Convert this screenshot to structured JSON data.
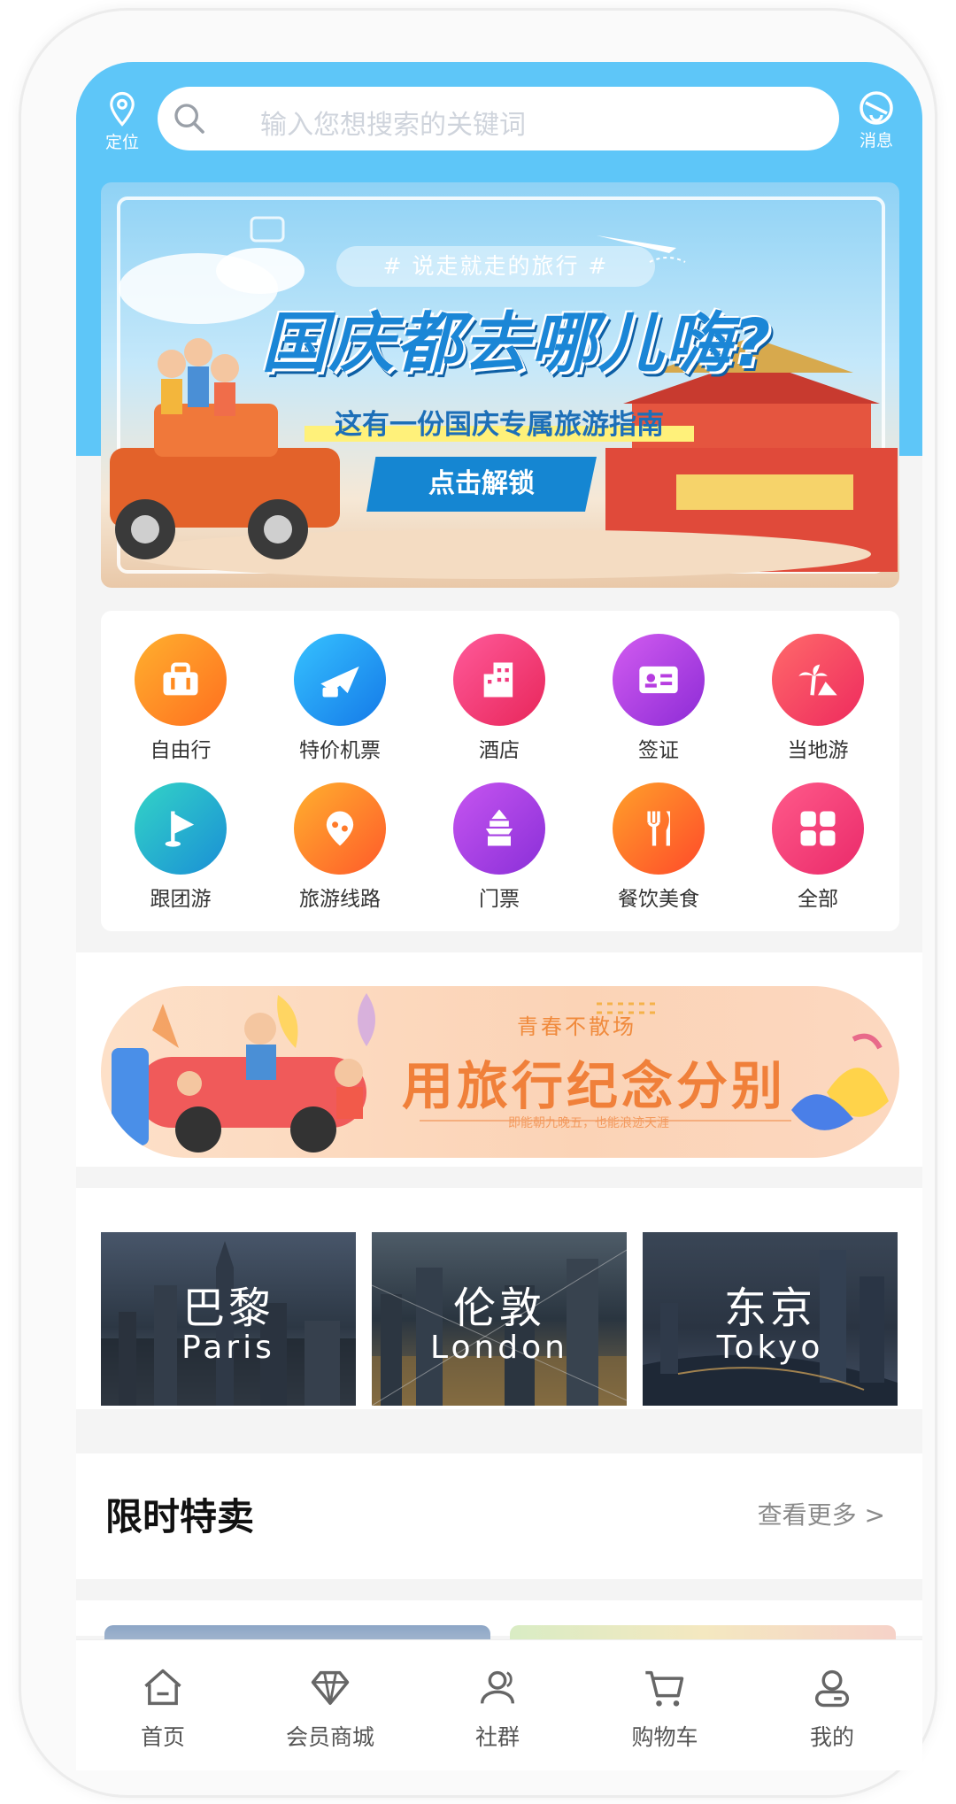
{
  "header": {
    "location_label": "定位",
    "search_placeholder": "输入您想搜索的关键词",
    "message_label": "消息"
  },
  "banner": {
    "tagline": "# 说走就走的旅行 #",
    "headline": "国庆都去哪儿嗨?",
    "subtitle": "这有一份国庆专属旅游指南",
    "button": "点击解锁"
  },
  "categories": [
    {
      "label": "自由行",
      "icon": "suitcase-icon",
      "color": "#ff8a1f"
    },
    {
      "label": "特价机票",
      "icon": "plane-icon",
      "color": "#1ea1f2"
    },
    {
      "label": "酒店",
      "icon": "building-icon",
      "color": "#f23c7e"
    },
    {
      "label": "签证",
      "icon": "id-card-icon",
      "color": "#b73de0"
    },
    {
      "label": "当地游",
      "icon": "palm-tree-icon",
      "color": "#f43f5e"
    },
    {
      "label": "跟团游",
      "icon": "flag-icon",
      "color": "#1fb8c9"
    },
    {
      "label": "旅游线路",
      "icon": "map-pin-icon",
      "color": "#ff7a2a"
    },
    {
      "label": "门票",
      "icon": "temple-icon",
      "color": "#a23ddf"
    },
    {
      "label": "餐饮美食",
      "icon": "fork-knife-icon",
      "color": "#ff6a2b"
    },
    {
      "label": "全部",
      "icon": "grid-icon",
      "color": "#f03a79"
    }
  ],
  "promo": {
    "kicker": "青春不散场",
    "headline": "用旅行纪念分别",
    "fine_print": "即能朝九晚五，也能浪迹天涯"
  },
  "cities": [
    {
      "cn": "巴黎",
      "en": "Paris"
    },
    {
      "cn": "伦敦",
      "en": "London"
    },
    {
      "cn": "东京",
      "en": "Tokyo"
    }
  ],
  "flash_sale": {
    "title": "限时特卖",
    "more": "查看更多 >"
  },
  "tabs": [
    {
      "label": "首页",
      "icon": "home-icon"
    },
    {
      "label": "会员商城",
      "icon": "diamond-icon"
    },
    {
      "label": "社群",
      "icon": "user-group-icon"
    },
    {
      "label": "购物车",
      "icon": "cart-icon"
    },
    {
      "label": "我的",
      "icon": "profile-icon"
    }
  ],
  "colors": {
    "header": "#5ec6f8",
    "promo_text": "#f0803a"
  }
}
